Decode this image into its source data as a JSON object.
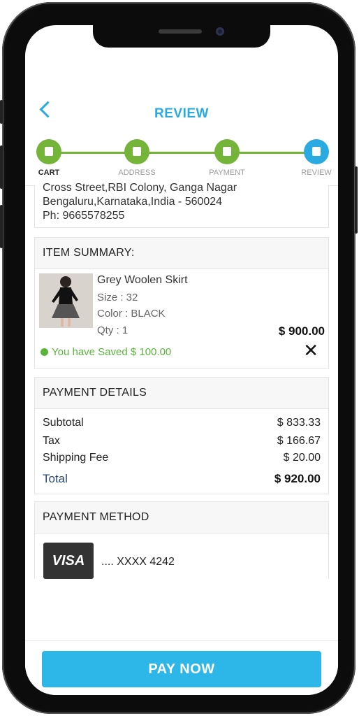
{
  "header": {
    "title": "REVIEW",
    "back_icon": "chevron-left-icon"
  },
  "stepper": {
    "steps": [
      {
        "label": "CART",
        "icon": "cart-icon",
        "color": "#74b438",
        "active": true
      },
      {
        "label": "ADDRESS",
        "icon": "address-book-icon",
        "color": "#74b438",
        "active": false
      },
      {
        "label": "PAYMENT",
        "icon": "credit-card-icon",
        "color": "#74b438",
        "active": false
      },
      {
        "label": "REVIEW",
        "icon": "document-icon",
        "color": "#29abe2",
        "active": false
      }
    ]
  },
  "address": {
    "lines": [
      "Cross Street,RBI Colony, Ganga Nagar",
      "Bengaluru,Karnataka,India - 560024",
      "Ph: 9665578255"
    ]
  },
  "item_summary": {
    "heading": "ITEM SUMMARY:",
    "name": "Grey Woolen Skirt",
    "size": "Size : 32",
    "color": "Color : BLACK",
    "qty": "Qty : 1",
    "price": "$ 900.00",
    "saved": "You have Saved $ 100.00",
    "remove_icon": "close-icon"
  },
  "payment_details": {
    "heading": "PAYMENT DETAILS",
    "subtotal_label": "Subtotal",
    "subtotal_value": "$ 833.33",
    "tax_label": "Tax",
    "tax_value": "$ 166.67",
    "shipping_label": "Shipping Fee",
    "shipping_value": "$ 20.00",
    "total_label": "Total",
    "total_value": "$ 920.00"
  },
  "payment_method": {
    "heading": "PAYMENT METHOD",
    "card_brand": "VISA",
    "card_number": ".... XXXX 4242"
  },
  "footer": {
    "pay_label": "PAY NOW"
  },
  "colors": {
    "accent": "#29abe2",
    "success": "#74b438",
    "button": "#2cb7e8"
  }
}
